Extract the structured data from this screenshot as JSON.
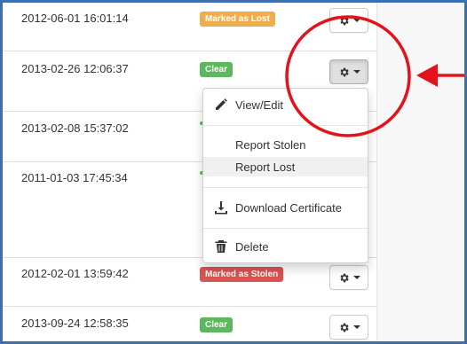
{
  "rows": [
    {
      "timestamp": "2012-06-01 16:01:14",
      "status": "Marked as Lost",
      "status_color": "#f0ad4e"
    },
    {
      "timestamp": "2013-02-26 12:06:37",
      "status": "Clear",
      "status_color": "#5cb85c"
    },
    {
      "timestamp": "2013-02-08 15:37:02",
      "status": "",
      "status_color": "#5cb85c"
    },
    {
      "timestamp": "2011-01-03 17:45:34",
      "status": "",
      "status_color": "#5cb85c"
    },
    {
      "timestamp": "2012-02-01 13:59:42",
      "status": "Marked as Stolen",
      "status_color": "#d9534f"
    },
    {
      "timestamp": "2013-09-24 12:58:35",
      "status": "Clear",
      "status_color": "#5cb85c"
    }
  ],
  "dropdown": {
    "items": [
      {
        "label": "View/Edit",
        "icon": "pencil-icon"
      },
      {
        "label": "Report Stolen",
        "icon": ""
      },
      {
        "label": "Report Lost",
        "icon": ""
      },
      {
        "label": "Download Certificate",
        "icon": "download-icon"
      },
      {
        "label": "Delete",
        "icon": "trash-icon"
      }
    ],
    "hovered_item": "Report Lost"
  },
  "actions_icon": "gear-icon",
  "annotation_color": "#e3131b",
  "frame_color": "#3d6fb0"
}
